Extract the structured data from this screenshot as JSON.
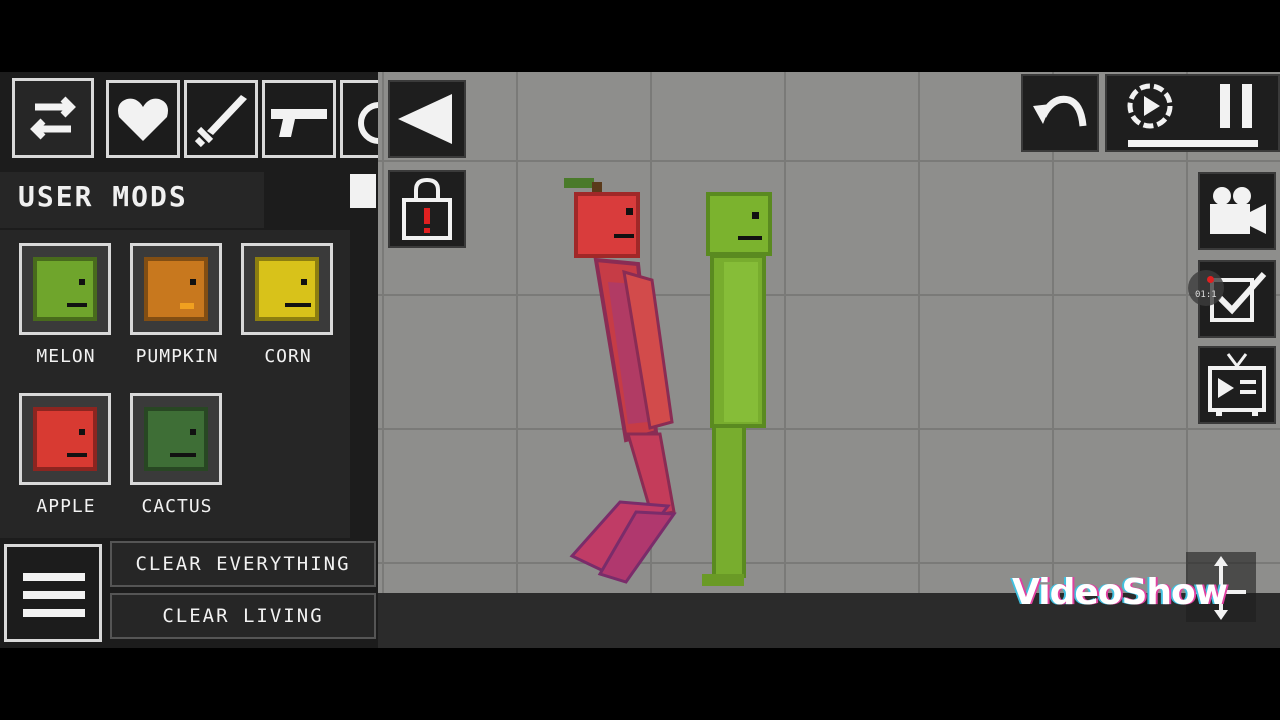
{
  "sidebar": {
    "header_title": "USER MODS",
    "items": [
      {
        "label": "MELON",
        "color": "#6fa52c",
        "icon": "melon-head"
      },
      {
        "label": "PUMPKIN",
        "color": "#c8781e",
        "icon": "pumpkin-head"
      },
      {
        "label": "CORN",
        "color": "#d8c21a",
        "icon": "corn-head"
      },
      {
        "label": "APPLE",
        "color": "#d83a32",
        "icon": "apple-head"
      },
      {
        "label": "CACTUS",
        "color": "#3e6e36",
        "icon": "cactus-head"
      }
    ],
    "categories": [
      "heart-icon",
      "sword-icon",
      "gun-icon",
      "grenade-icon"
    ]
  },
  "actions": {
    "clear_everything": "CLEAR EVERYTHING",
    "clear_living": "CLEAR LIVING"
  },
  "overlay": {
    "watermark": "VideoShow",
    "record_time": "01:1"
  },
  "colors": {
    "world_bg": "#8e8e8c",
    "panel_bg": "#1c1c1c",
    "ground": "#2b2b2b"
  }
}
